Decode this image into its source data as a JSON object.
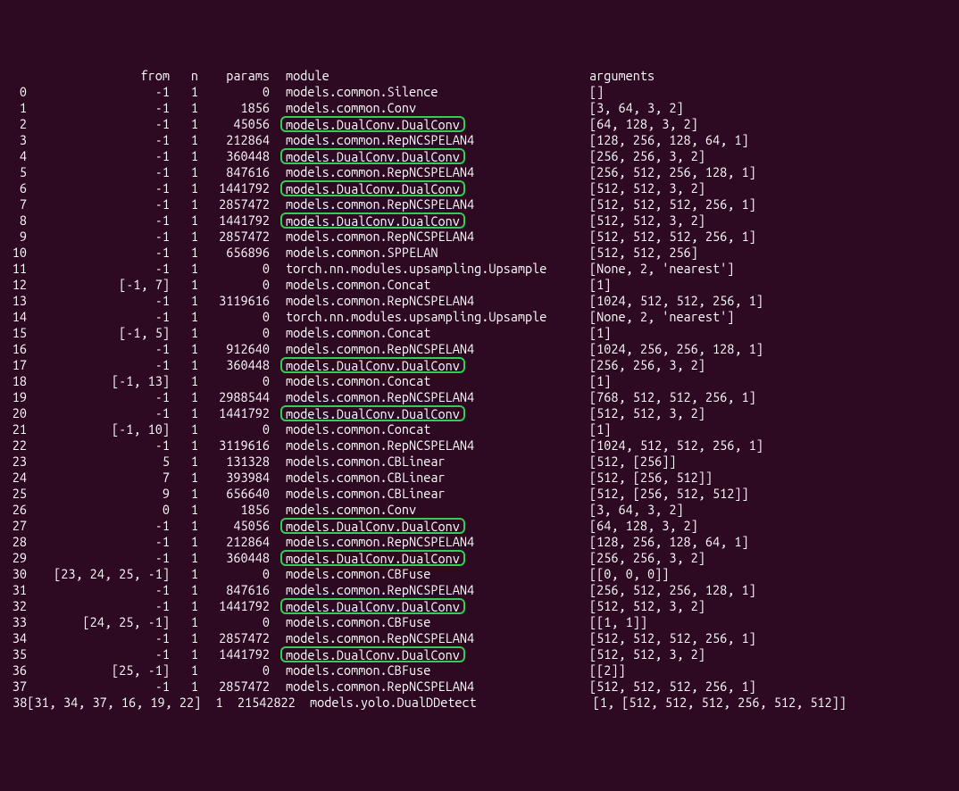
{
  "header": {
    "idx": "",
    "from": "from",
    "n": "n",
    "params": "params",
    "module": "module",
    "args": "arguments"
  },
  "rows": [
    {
      "idx": "0",
      "from": "-1",
      "n": "1",
      "params": "0",
      "module": "models.common.Silence",
      "args": "[]",
      "hl": false
    },
    {
      "idx": "1",
      "from": "-1",
      "n": "1",
      "params": "1856",
      "module": "models.common.Conv",
      "args": "[3, 64, 3, 2]",
      "hl": false
    },
    {
      "idx": "2",
      "from": "-1",
      "n": "1",
      "params": "45056",
      "module": "models.DualConv.DualConv",
      "args": "[64, 128, 3, 2]",
      "hl": true
    },
    {
      "idx": "3",
      "from": "-1",
      "n": "1",
      "params": "212864",
      "module": "models.common.RepNCSPELAN4",
      "args": "[128, 256, 128, 64, 1]",
      "hl": false
    },
    {
      "idx": "4",
      "from": "-1",
      "n": "1",
      "params": "360448",
      "module": "models.DualConv.DualConv",
      "args": "[256, 256, 3, 2]",
      "hl": true
    },
    {
      "idx": "5",
      "from": "-1",
      "n": "1",
      "params": "847616",
      "module": "models.common.RepNCSPELAN4",
      "args": "[256, 512, 256, 128, 1]",
      "hl": false
    },
    {
      "idx": "6",
      "from": "-1",
      "n": "1",
      "params": "1441792",
      "module": "models.DualConv.DualConv",
      "args": "[512, 512, 3, 2]",
      "hl": true
    },
    {
      "idx": "7",
      "from": "-1",
      "n": "1",
      "params": "2857472",
      "module": "models.common.RepNCSPELAN4",
      "args": "[512, 512, 512, 256, 1]",
      "hl": false
    },
    {
      "idx": "8",
      "from": "-1",
      "n": "1",
      "params": "1441792",
      "module": "models.DualConv.DualConv",
      "args": "[512, 512, 3, 2]",
      "hl": true
    },
    {
      "idx": "9",
      "from": "-1",
      "n": "1",
      "params": "2857472",
      "module": "models.common.RepNCSPELAN4",
      "args": "[512, 512, 512, 256, 1]",
      "hl": false
    },
    {
      "idx": "10",
      "from": "-1",
      "n": "1",
      "params": "656896",
      "module": "models.common.SPPELAN",
      "args": "[512, 512, 256]",
      "hl": false
    },
    {
      "idx": "11",
      "from": "-1",
      "n": "1",
      "params": "0",
      "module": "torch.nn.modules.upsampling.Upsample",
      "args": "[None, 2, 'nearest']",
      "hl": false
    },
    {
      "idx": "12",
      "from": "[-1, 7]",
      "n": "1",
      "params": "0",
      "module": "models.common.Concat",
      "args": "[1]",
      "hl": false
    },
    {
      "idx": "13",
      "from": "-1",
      "n": "1",
      "params": "3119616",
      "module": "models.common.RepNCSPELAN4",
      "args": "[1024, 512, 512, 256, 1]",
      "hl": false
    },
    {
      "idx": "14",
      "from": "-1",
      "n": "1",
      "params": "0",
      "module": "torch.nn.modules.upsampling.Upsample",
      "args": "[None, 2, 'nearest']",
      "hl": false
    },
    {
      "idx": "15",
      "from": "[-1, 5]",
      "n": "1",
      "params": "0",
      "module": "models.common.Concat",
      "args": "[1]",
      "hl": false
    },
    {
      "idx": "16",
      "from": "-1",
      "n": "1",
      "params": "912640",
      "module": "models.common.RepNCSPELAN4",
      "args": "[1024, 256, 256, 128, 1]",
      "hl": false
    },
    {
      "idx": "17",
      "from": "-1",
      "n": "1",
      "params": "360448",
      "module": "models.DualConv.DualConv",
      "args": "[256, 256, 3, 2]",
      "hl": true
    },
    {
      "idx": "18",
      "from": "[-1, 13]",
      "n": "1",
      "params": "0",
      "module": "models.common.Concat",
      "args": "[1]",
      "hl": false
    },
    {
      "idx": "19",
      "from": "-1",
      "n": "1",
      "params": "2988544",
      "module": "models.common.RepNCSPELAN4",
      "args": "[768, 512, 512, 256, 1]",
      "hl": false
    },
    {
      "idx": "20",
      "from": "-1",
      "n": "1",
      "params": "1441792",
      "module": "models.DualConv.DualConv",
      "args": "[512, 512, 3, 2]",
      "hl": true
    },
    {
      "idx": "21",
      "from": "[-1, 10]",
      "n": "1",
      "params": "0",
      "module": "models.common.Concat",
      "args": "[1]",
      "hl": false
    },
    {
      "idx": "22",
      "from": "-1",
      "n": "1",
      "params": "3119616",
      "module": "models.common.RepNCSPELAN4",
      "args": "[1024, 512, 512, 256, 1]",
      "hl": false
    },
    {
      "idx": "23",
      "from": "5",
      "n": "1",
      "params": "131328",
      "module": "models.common.CBLinear",
      "args": "[512, [256]]",
      "hl": false
    },
    {
      "idx": "24",
      "from": "7",
      "n": "1",
      "params": "393984",
      "module": "models.common.CBLinear",
      "args": "[512, [256, 512]]",
      "hl": false
    },
    {
      "idx": "25",
      "from": "9",
      "n": "1",
      "params": "656640",
      "module": "models.common.CBLinear",
      "args": "[512, [256, 512, 512]]",
      "hl": false
    },
    {
      "idx": "26",
      "from": "0",
      "n": "1",
      "params": "1856",
      "module": "models.common.Conv",
      "args": "[3, 64, 3, 2]",
      "hl": false
    },
    {
      "idx": "27",
      "from": "-1",
      "n": "1",
      "params": "45056",
      "module": "models.DualConv.DualConv",
      "args": "[64, 128, 3, 2]",
      "hl": true
    },
    {
      "idx": "28",
      "from": "-1",
      "n": "1",
      "params": "212864",
      "module": "models.common.RepNCSPELAN4",
      "args": "[128, 256, 128, 64, 1]",
      "hl": false
    },
    {
      "idx": "29",
      "from": "-1",
      "n": "1",
      "params": "360448",
      "module": "models.DualConv.DualConv",
      "args": "[256, 256, 3, 2]",
      "hl": true
    },
    {
      "idx": "30",
      "from": "[23, 24, 25, -1]",
      "n": "1",
      "params": "0",
      "module": "models.common.CBFuse",
      "args": "[[0, 0, 0]]",
      "hl": false
    },
    {
      "idx": "31",
      "from": "-1",
      "n": "1",
      "params": "847616",
      "module": "models.common.RepNCSPELAN4",
      "args": "[256, 512, 256, 128, 1]",
      "hl": false
    },
    {
      "idx": "32",
      "from": "-1",
      "n": "1",
      "params": "1441792",
      "module": "models.DualConv.DualConv",
      "args": "[512, 512, 3, 2]",
      "hl": true
    },
    {
      "idx": "33",
      "from": "[24, 25, -1]",
      "n": "1",
      "params": "0",
      "module": "models.common.CBFuse",
      "args": "[[1, 1]]",
      "hl": false
    },
    {
      "idx": "34",
      "from": "-1",
      "n": "1",
      "params": "2857472",
      "module": "models.common.RepNCSPELAN4",
      "args": "[512, 512, 512, 256, 1]",
      "hl": false
    },
    {
      "idx": "35",
      "from": "-1",
      "n": "1",
      "params": "1441792",
      "module": "models.DualConv.DualConv",
      "args": "[512, 512, 3, 2]",
      "hl": true
    },
    {
      "idx": "36",
      "from": "[25, -1]",
      "n": "1",
      "params": "0",
      "module": "models.common.CBFuse",
      "args": "[[2]]",
      "hl": false
    },
    {
      "idx": "37",
      "from": "-1",
      "n": "1",
      "params": "2857472",
      "module": "models.common.RepNCSPELAN4",
      "args": "[512, 512, 512, 256, 1]",
      "hl": false
    }
  ],
  "lastRow": {
    "idx": "38",
    "from": "[31, 34, 37, 16, 19, 22]",
    "n": "1",
    "params": "21542822",
    "module": "models.yolo.DualDDetect",
    "args": "[1, [512, 512, 512, 256, 512, 512]]"
  }
}
